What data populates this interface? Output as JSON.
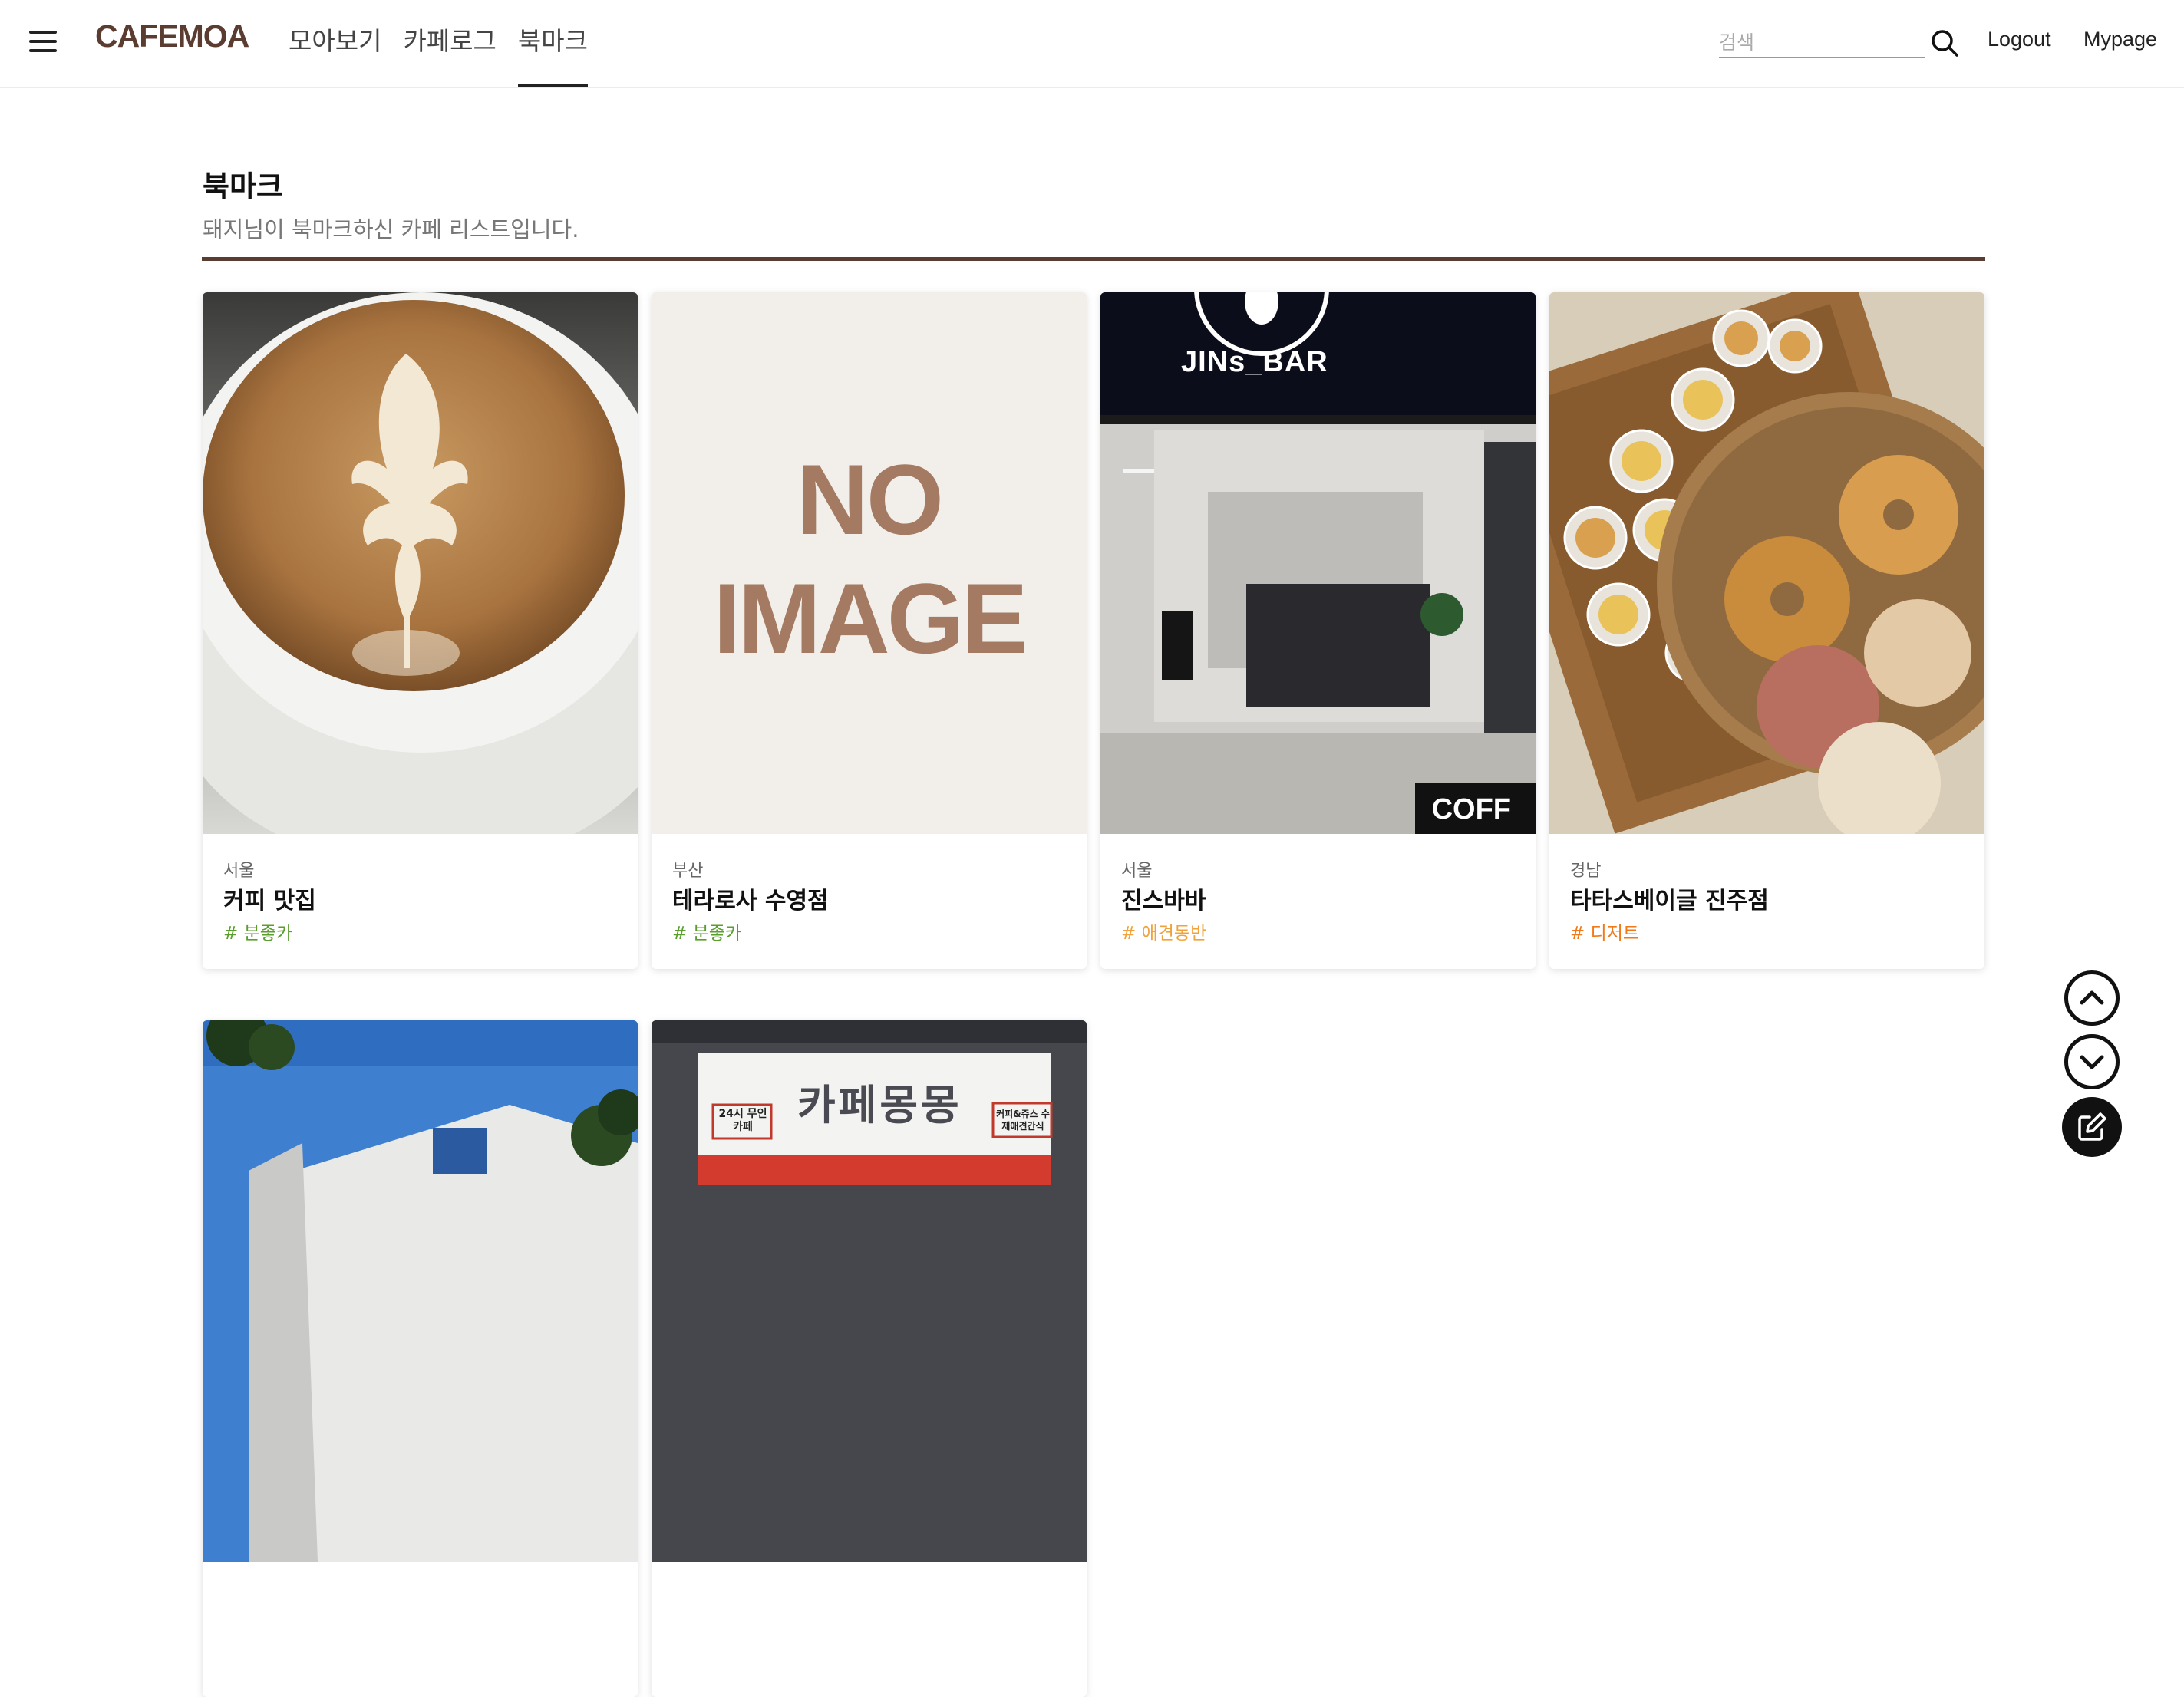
{
  "header": {
    "logo": "CAFEMOA",
    "nav": [
      {
        "label": "모아보기",
        "active": false
      },
      {
        "label": "카페로그",
        "active": false
      },
      {
        "label": "북마크",
        "active": true
      }
    ],
    "search_placeholder": "검색",
    "search_value": "",
    "logout_label": "Logout",
    "mypage_label": "Mypage",
    "icons": {
      "menu": "hamburger-menu-icon",
      "search": "search-icon"
    }
  },
  "page": {
    "title": "북마크",
    "subtitle": "돼지님이 북마크하신 카페 리스트입니다."
  },
  "cards": [
    {
      "region": "서울",
      "name": "커피 맛집",
      "tag": "# 분좋카",
      "tag_color": "#5a9e2e",
      "image": "latte-art-photo"
    },
    {
      "region": "부산",
      "name": "테라로사 수영점",
      "tag": "# 분좋카",
      "tag_color": "#5a9e2e",
      "image": "no-image-placeholder",
      "placeholder_line1": "NO",
      "placeholder_line2": "IMAGE"
    },
    {
      "region": "서울",
      "name": "진스바바",
      "tag": "# 애견동반",
      "tag_color": "#f0a33c",
      "image": "cafe-interior-photo",
      "sign_text": "JINs_BAR",
      "open_text": "OPEN COFFEE"
    },
    {
      "region": "경남",
      "name": "타타스베이글 진주점",
      "tag": "# 디저트",
      "tag_color": "#f07a1a",
      "image": "bagel-basket-photo"
    },
    {
      "image": "building-sky-photo"
    },
    {
      "image": "cafe-storefront-photo",
      "sign_text": "카페몽몽",
      "sign_left": "24시 무인카페",
      "sign_right": "커피&쥬스 수제애견간식"
    }
  ],
  "colors": {
    "brand": "#5a3d30",
    "divider": "#5a3d30",
    "placeholder_bg": "#f2efeb",
    "placeholder_text": "#a47b62"
  },
  "floating_buttons": [
    {
      "name": "scroll-up",
      "icon": "chevron-up-icon"
    },
    {
      "name": "scroll-down",
      "icon": "chevron-down-icon"
    },
    {
      "name": "write",
      "icon": "edit-icon"
    }
  ]
}
